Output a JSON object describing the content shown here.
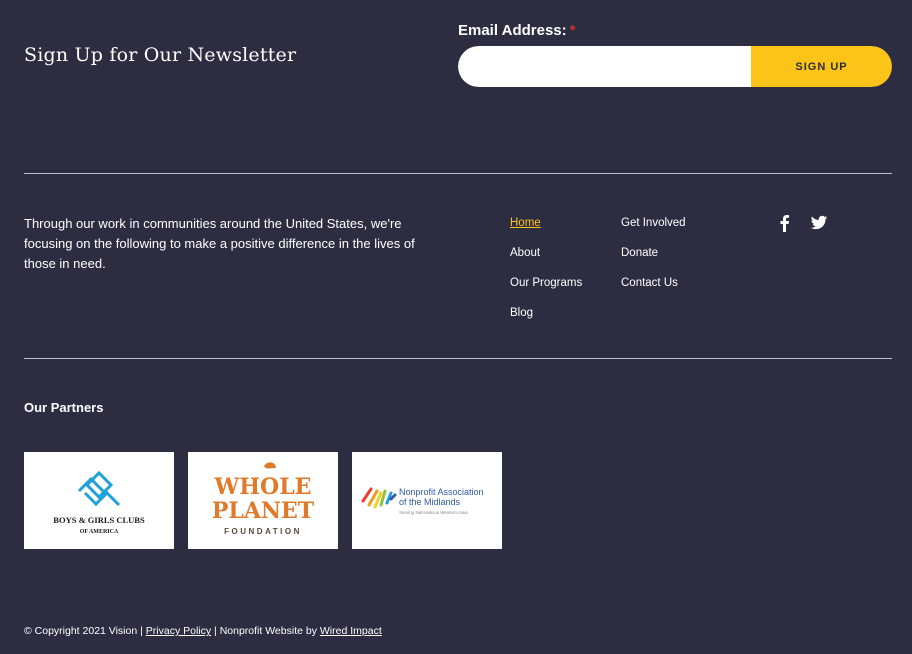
{
  "newsletter": {
    "title": "Sign Up for Our Newsletter",
    "email_label": "Email Address:",
    "required_mark": "*",
    "email_value": "",
    "signup_label": "SIGN UP"
  },
  "mission_text": "Through our work in communities around the United States, we're focusing on the following to make a positive difference in the lives of those in need.",
  "nav": {
    "col1": [
      {
        "label": "Home",
        "active": true
      },
      {
        "label": "About"
      },
      {
        "label": "Our Programs"
      },
      {
        "label": "Blog"
      }
    ],
    "col2": [
      {
        "label": "Get Involved"
      },
      {
        "label": "Donate"
      },
      {
        "label": "Contact Us"
      }
    ]
  },
  "social": [
    "facebook-icon",
    "twitter-icon"
  ],
  "partners": {
    "title": "Our Partners",
    "logos": [
      {
        "name": "boys-girls-clubs-logo",
        "line1": "BOYS & GIRLS CLUBS",
        "line2": "OF AMERICA"
      },
      {
        "name": "whole-planet-logo",
        "line1": "WHOLE",
        "line2": "PLANET",
        "line3": "FOUNDATION"
      },
      {
        "name": "nonprofit-association-logo",
        "line1": "Nonprofit Association",
        "line2": "of the Midlands",
        "line3": "Serving Nebraska & Western Iowa"
      }
    ]
  },
  "footer": {
    "copyright": "© Copyright 2021 Vision |",
    "privacy": "Privacy Policy",
    "mid": "| Nonprofit Website by",
    "wired": "Wired Impact"
  },
  "colors": {
    "background": "#2d2d42",
    "accent": "#fcc419",
    "text": "#ffffff"
  }
}
